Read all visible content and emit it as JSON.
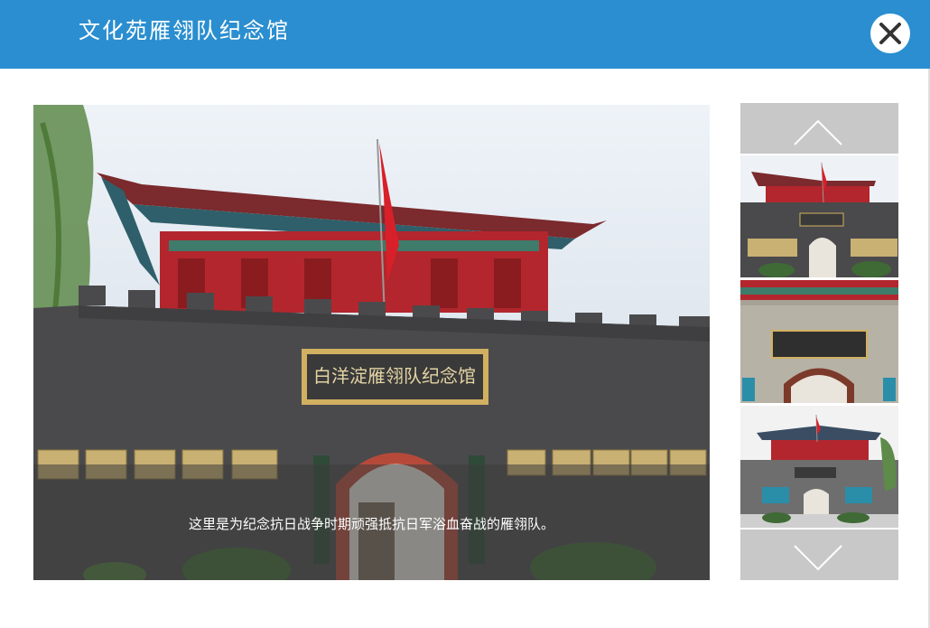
{
  "header": {
    "title": "文化苑雁翎队纪念馆",
    "close_icon": "close-icon"
  },
  "main": {
    "sign_text": "白洋淀雁翎队纪念馆",
    "caption": "这里是为纪念抗日战争时期顽强抵抗日军浴血奋战的雁翎队。"
  },
  "thumbs": {
    "prev_icon": "chevron-up-icon",
    "next_icon": "chevron-down-icon",
    "selected_index": 1,
    "items": [
      {
        "name": "museum-front-thumbnail"
      },
      {
        "name": "museum-sign-thumbnail"
      },
      {
        "name": "museum-wide-thumbnail"
      }
    ]
  },
  "colors": {
    "header_bg": "#2a8ed0",
    "nav_bg": "#c8c8c8",
    "wall": "#4a4a4c",
    "roof_red": "#b3262d"
  }
}
